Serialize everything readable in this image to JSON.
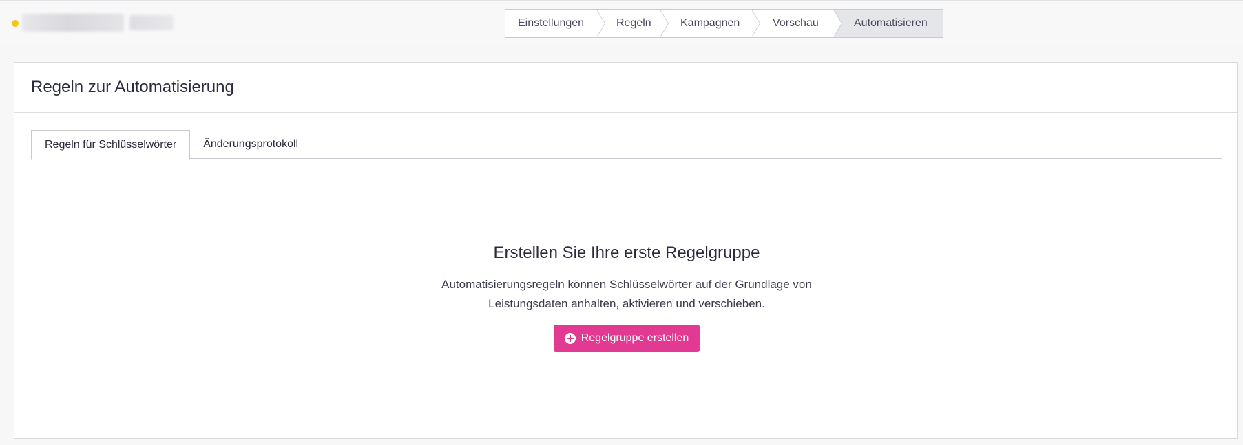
{
  "header": {
    "status_color": "#f5c518"
  },
  "stepper": {
    "steps": [
      {
        "label": "Einstellungen"
      },
      {
        "label": "Regeln"
      },
      {
        "label": "Kampagnen"
      },
      {
        "label": "Vorschau"
      },
      {
        "label": "Automatisieren",
        "active": true
      }
    ]
  },
  "card": {
    "title": "Regeln zur Automatisierung",
    "tabs": [
      {
        "label": "Regeln für Schlüsselwörter",
        "active": true
      },
      {
        "label": "Änderungsprotokoll"
      }
    ]
  },
  "empty_state": {
    "title": "Erstellen Sie Ihre erste Regelgruppe",
    "description_line1": "Automatisierungsregeln können Schlüsselwörter auf der Grundlage von",
    "description_line2": "Leistungsdaten anhalten, aktivieren und verschieben.",
    "button_label": "Regelgruppe erstellen",
    "button_color": "#e23a92"
  }
}
